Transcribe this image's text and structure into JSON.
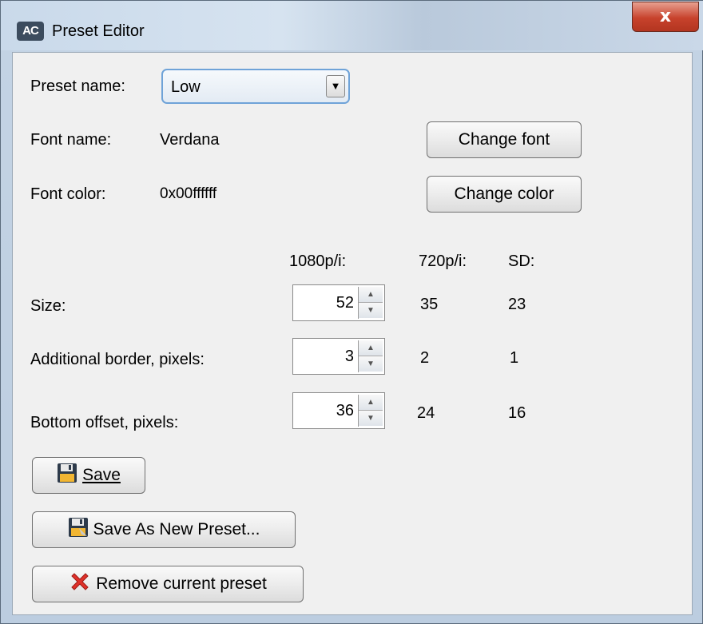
{
  "window": {
    "title": "Preset Editor",
    "icon_text": "AC",
    "close_glyph": "x"
  },
  "preset": {
    "label": "Preset name:",
    "value": "Low"
  },
  "font": {
    "label": "Font name:",
    "value": "Verdana",
    "button": "Change font"
  },
  "color": {
    "label": "Font color:",
    "value": "0x00ffffff",
    "button": "Change color"
  },
  "columns": {
    "c1080": "1080p/i:",
    "c720": "720p/i:",
    "csd": "SD:"
  },
  "rows": [
    {
      "label": "Size:",
      "v1080": "52",
      "v720": "35",
      "vsd": "23"
    },
    {
      "label": "Additional border, pixels:",
      "v1080": "3",
      "v720": "2",
      "vsd": "1"
    },
    {
      "label": "Bottom offset, pixels:",
      "v1080": "36",
      "v720": "24",
      "vsd": "16"
    }
  ],
  "buttons": {
    "save": "Save",
    "save_as": "Save As New Preset...",
    "remove": "Remove current preset"
  },
  "icons": {
    "save": "floppy-disk-icon",
    "save_as": "floppy-disk-icon",
    "remove": "red-x-icon"
  }
}
